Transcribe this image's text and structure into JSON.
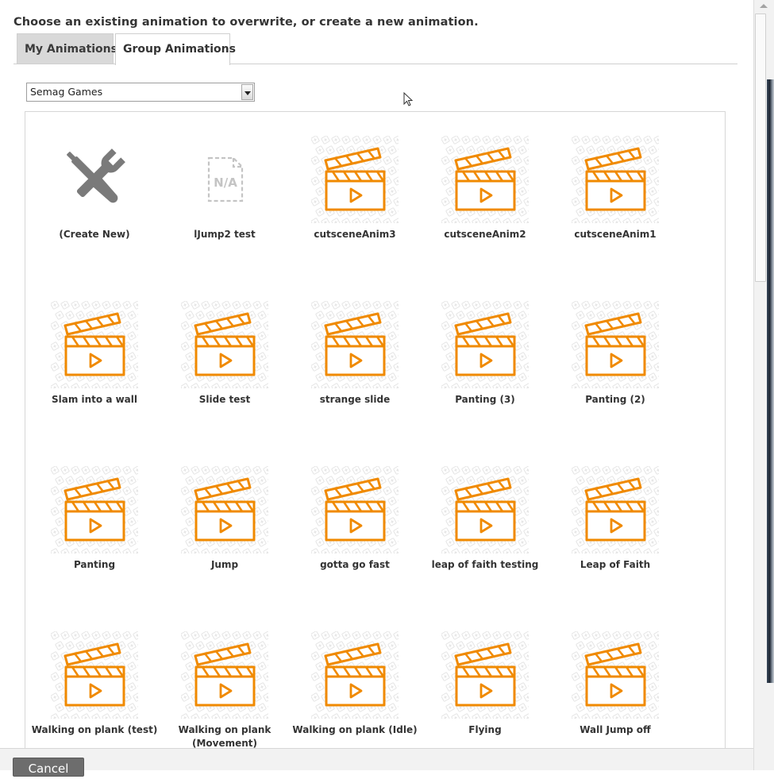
{
  "instruction": "Choose an existing animation to overwrite, or create a new animation.",
  "tabs": [
    {
      "label": "My Animations",
      "active": false
    },
    {
      "label": "Group Animations",
      "active": true
    }
  ],
  "group_select": {
    "value": "Semag Games"
  },
  "items": [
    {
      "label": "(Create New)",
      "icon": "wrench-screwdriver-icon"
    },
    {
      "label": "lJump2 test",
      "icon": "na-placeholder-icon"
    },
    {
      "label": "cutsceneAnim3",
      "icon": "clapperboard-icon"
    },
    {
      "label": "cutsceneAnim2",
      "icon": "clapperboard-icon"
    },
    {
      "label": "cutsceneAnim1",
      "icon": "clapperboard-icon"
    },
    {
      "label": "Slam into a wall",
      "icon": "clapperboard-icon"
    },
    {
      "label": "Slide test",
      "icon": "clapperboard-icon"
    },
    {
      "label": "strange slide",
      "icon": "clapperboard-icon"
    },
    {
      "label": "Panting (3)",
      "icon": "clapperboard-icon"
    },
    {
      "label": "Panting (2)",
      "icon": "clapperboard-icon"
    },
    {
      "label": "Panting",
      "icon": "clapperboard-icon"
    },
    {
      "label": "Jump",
      "icon": "clapperboard-icon"
    },
    {
      "label": "gotta go fast",
      "icon": "clapperboard-icon"
    },
    {
      "label": "leap of faith testing",
      "icon": "clapperboard-icon"
    },
    {
      "label": "Leap of Faith",
      "icon": "clapperboard-icon"
    },
    {
      "label": "Walking on plank (test)",
      "icon": "clapperboard-icon"
    },
    {
      "label": "Walking on plank (Movement)",
      "icon": "clapperboard-icon"
    },
    {
      "label": "Walking on plank (Idle)",
      "icon": "clapperboard-icon"
    },
    {
      "label": "Flying",
      "icon": "clapperboard-icon"
    },
    {
      "label": "Wall Jump off",
      "icon": "clapperboard-icon"
    }
  ],
  "footer": {
    "cancel_label": "Cancel"
  },
  "colors": {
    "accent_orange": "#f08a00",
    "tool_gray": "#7a7a7a",
    "tab_inactive_bg": "#d9d9d9"
  }
}
